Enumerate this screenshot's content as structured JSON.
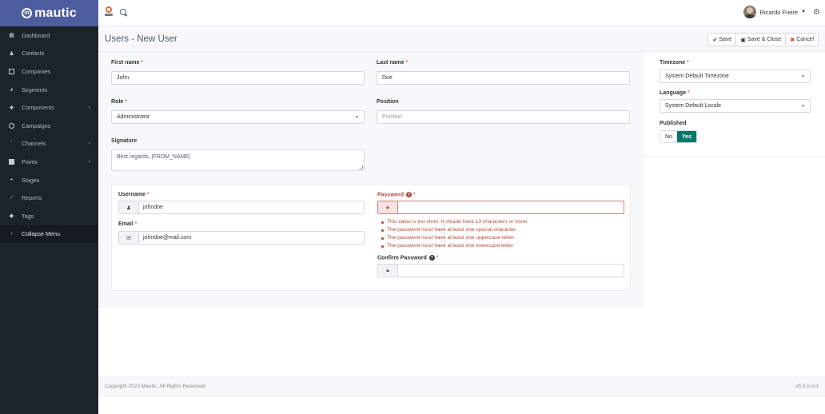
{
  "app": {
    "brand": "mautic"
  },
  "sidebar": {
    "items": [
      {
        "label": "Dashboard",
        "icon": "dashboard-icon",
        "has_children": false
      },
      {
        "label": "Contacts",
        "icon": "user-icon",
        "has_children": false
      },
      {
        "label": "Companies",
        "icon": "building-icon",
        "has_children": false
      },
      {
        "label": "Segments",
        "icon": "pie-chart-icon",
        "has_children": false
      },
      {
        "label": "Components",
        "icon": "puzzle-icon",
        "has_children": true
      },
      {
        "label": "Campaigns",
        "icon": "clock-icon",
        "has_children": false
      },
      {
        "label": "Channels",
        "icon": "rss-icon",
        "has_children": true
      },
      {
        "label": "Points",
        "icon": "calculator-icon",
        "has_children": true
      },
      {
        "label": "Stages",
        "icon": "tachometer-icon",
        "has_children": false
      },
      {
        "label": "Reports",
        "icon": "line-chart-icon",
        "has_children": false
      },
      {
        "label": "Tags",
        "icon": "tag-icon",
        "has_children": false
      }
    ],
    "collapse_label": "Collapse Menu"
  },
  "topbar": {
    "user_name": "Ricardo Freire"
  },
  "page": {
    "title": "Users - New User",
    "buttons": {
      "save": "Save",
      "save_close": "Save & Close",
      "cancel": "Cancel"
    }
  },
  "form": {
    "first_name": {
      "label": "First name",
      "value": "John"
    },
    "last_name": {
      "label": "Last name",
      "value": "Doe"
    },
    "role": {
      "label": "Role",
      "value": "Administrator"
    },
    "position": {
      "label": "Position",
      "placeholder": "Position"
    },
    "signature": {
      "label": "Signature",
      "value": "Best regards, |FROM_NAME|"
    },
    "username": {
      "label": "Username",
      "value": "johndoe"
    },
    "email": {
      "label": "Email",
      "value": "johndoe@mail.com"
    },
    "password": {
      "label": "Password",
      "errors": [
        "This value is too short. It should have 13 characters or more.",
        "The password must have at least one special character.",
        "The password must have at least one uppercase letter.",
        "The password must have at least one lowercase letter."
      ]
    },
    "confirm_password": {
      "label": "Confirm Password"
    },
    "required_mark": "*"
  },
  "settings": {
    "timezone": {
      "label": "Timezone",
      "value": "System Default Timezone"
    },
    "language": {
      "label": "Language",
      "value": "System Default Locale"
    },
    "published": {
      "label": "Published",
      "no": "No",
      "yes": "Yes"
    }
  },
  "footer": {
    "copyright": "Copyright 2023 Mautic. All Rights Reserved.",
    "version": "v5.0.0-rc1"
  },
  "colors": {
    "sidebar_bg": "#1c2329",
    "brand_bg": "#4e5d9d",
    "error": "#b14a3e",
    "toggle_on": "#00796b"
  }
}
